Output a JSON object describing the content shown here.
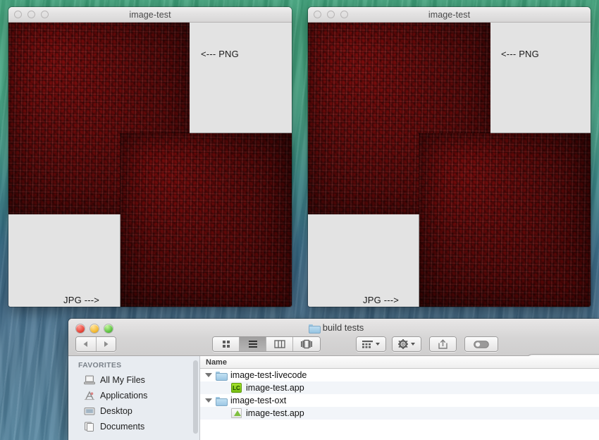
{
  "desktop": {
    "name": "os-x-mavericks-wave-wallpaper"
  },
  "windows": [
    {
      "title": "image-test",
      "active": false,
      "traffic_lights": [
        "close",
        "minimize",
        "zoom"
      ],
      "png_label": "<--- PNG",
      "jpg_label": "JPG --->"
    },
    {
      "title": "image-test",
      "active": false,
      "traffic_lights": [
        "close",
        "minimize",
        "zoom"
      ],
      "png_label": "<--- PNG",
      "jpg_label": "JPG --->"
    }
  ],
  "finder": {
    "title": "build tests",
    "title_icon": "folder-icon",
    "traffic_lights": {
      "close": "close",
      "minimize": "minimize",
      "zoom": "zoom"
    },
    "nav": {
      "back": "back-icon",
      "forward": "forward-icon"
    },
    "view_modes": [
      {
        "name": "icon-view",
        "icon": "grid-icon",
        "selected": false
      },
      {
        "name": "list-view",
        "icon": "list-icon",
        "selected": true
      },
      {
        "name": "column-view",
        "icon": "columns-icon",
        "selected": false
      },
      {
        "name": "coverflow-view",
        "icon": "coverflow-icon",
        "selected": false
      }
    ],
    "toolbar_buttons": [
      {
        "name": "arrange-by",
        "icon": "grid-dots-icon",
        "has_caret": true
      },
      {
        "name": "action-menu",
        "icon": "gear-icon",
        "has_caret": true
      },
      {
        "name": "share",
        "icon": "share-icon",
        "has_caret": false
      },
      {
        "name": "tags",
        "icon": "tag-pill-icon",
        "has_caret": false
      }
    ],
    "search": {
      "icon": "search-icon",
      "value": "",
      "placeholder": ""
    },
    "sidebar": {
      "section_header": "FAVORITES",
      "items": [
        {
          "label": "All My Files",
          "icon": "all-my-files-icon"
        },
        {
          "label": "Applications",
          "icon": "applications-icon"
        },
        {
          "label": "Desktop",
          "icon": "desktop-icon"
        },
        {
          "label": "Documents",
          "icon": "documents-icon"
        }
      ]
    },
    "filelist": {
      "column_header": "Name",
      "rows": [
        {
          "label": "image-test-livecode",
          "type": "folder",
          "level": 0,
          "expanded": true,
          "icon": "folder-icon"
        },
        {
          "label": "image-test.app",
          "type": "app",
          "level": 1,
          "expanded": false,
          "icon": "livecode-app-icon"
        },
        {
          "label": "image-test-oxt",
          "type": "folder",
          "level": 0,
          "expanded": true,
          "icon": "folder-icon"
        },
        {
          "label": "image-test.app",
          "type": "app",
          "level": 1,
          "expanded": false,
          "icon": "openoffice-app-icon"
        }
      ]
    }
  },
  "colors": {
    "image_png_red": "#8c0d0d",
    "image_jpg_red": "#7c0a0a",
    "panel_gray": "#e3e3e3",
    "wallpaper_top": "#3fa47c",
    "wallpaper_bottom": "#52839e"
  }
}
